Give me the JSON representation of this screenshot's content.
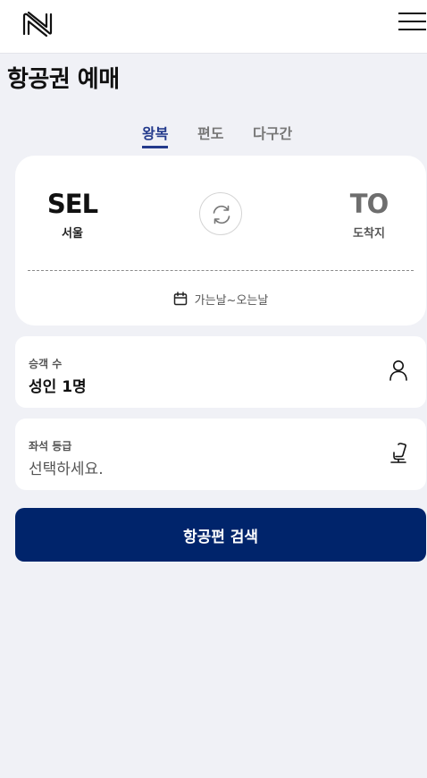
{
  "header": {
    "logo": "N-logo-icon",
    "menu_icon": "hamburger-menu-icon"
  },
  "page_title": "항공권 예매",
  "tabs": [
    {
      "label": "왕복",
      "active": true
    },
    {
      "label": "편도",
      "active": false
    },
    {
      "label": "다구간",
      "active": false
    }
  ],
  "route": {
    "from_code": "SEL",
    "from_city": "서울",
    "to_code": "TO",
    "to_city": "도착지",
    "swap_icon": "swap-refresh-icon",
    "date_icon": "calendar-icon",
    "date_placeholder": "가는날~오는날"
  },
  "passengers": {
    "label": "승객 수",
    "value": "성인 1명",
    "icon": "person-icon"
  },
  "seat_class": {
    "label": "좌석 등급",
    "value": "선택하세요.",
    "icon": "seat-icon"
  },
  "search_button": "항공편 검색",
  "colors": {
    "accent": "#233a8c",
    "primary_button": "#00246b",
    "background": "#f0f1f6"
  }
}
